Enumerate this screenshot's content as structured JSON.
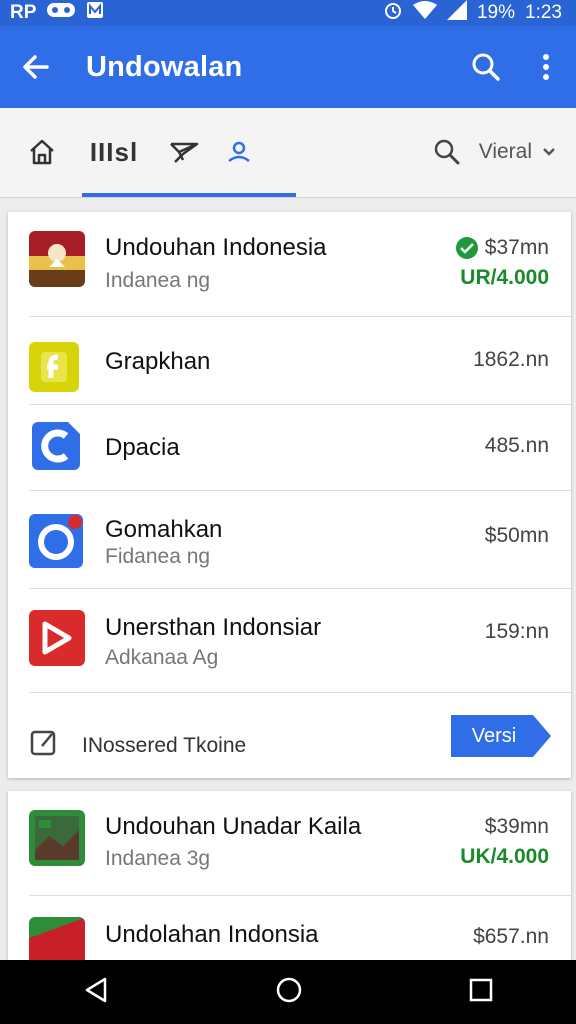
{
  "status_bar": {
    "carrier": "RP",
    "battery": "19%",
    "time": "1:23"
  },
  "app_bar": {
    "title": "Undowalan"
  },
  "tabs": [
    {
      "name": "home"
    },
    {
      "name": "apps",
      "label": "IIIsl"
    },
    {
      "name": "airplane"
    },
    {
      "name": "account"
    }
  ],
  "sort": {
    "label": "Vieral"
  },
  "apps": [
    {
      "name": "Undouhan Indonesia",
      "sub": "Indanea ng",
      "price": "$37mn",
      "price2": "UR/4.000",
      "icon_color": "#c8202a"
    },
    {
      "name": "Grapkhan",
      "sub": "",
      "price": "1862.nn",
      "price2": "",
      "icon_color": "#d8d40a"
    },
    {
      "name": "Dpacia",
      "sub": "",
      "price": "485.nn",
      "price2": "",
      "icon_color": "#2f6ee6"
    },
    {
      "name": "Gomahkan",
      "sub": "Fidanea ng",
      "price": "$50mn",
      "price2": "",
      "icon_color": "#2f6ee6"
    },
    {
      "name": "Unersthan Indonsiar",
      "sub": "Adkanaa Ag",
      "price": "159:nn",
      "price2": "",
      "icon_color": "#d92b2b"
    }
  ],
  "footer": {
    "label": "INossered Tkoine",
    "button": "Versi"
  },
  "apps2": [
    {
      "name": "Undouhan Unadar Kaila",
      "sub": "Indanea 3g",
      "price": "$39mn",
      "price2": "UK/4.000",
      "icon_color": "#2f8d3a"
    },
    {
      "name": "Undolahan Indonsia",
      "sub": "",
      "price": "$657.nn",
      "price2": "",
      "icon_color": "#c8202a"
    }
  ],
  "colors": {
    "primary": "#2f6ee6",
    "status_bar": "#2a63d4",
    "price_green": "#1a8a2a"
  }
}
